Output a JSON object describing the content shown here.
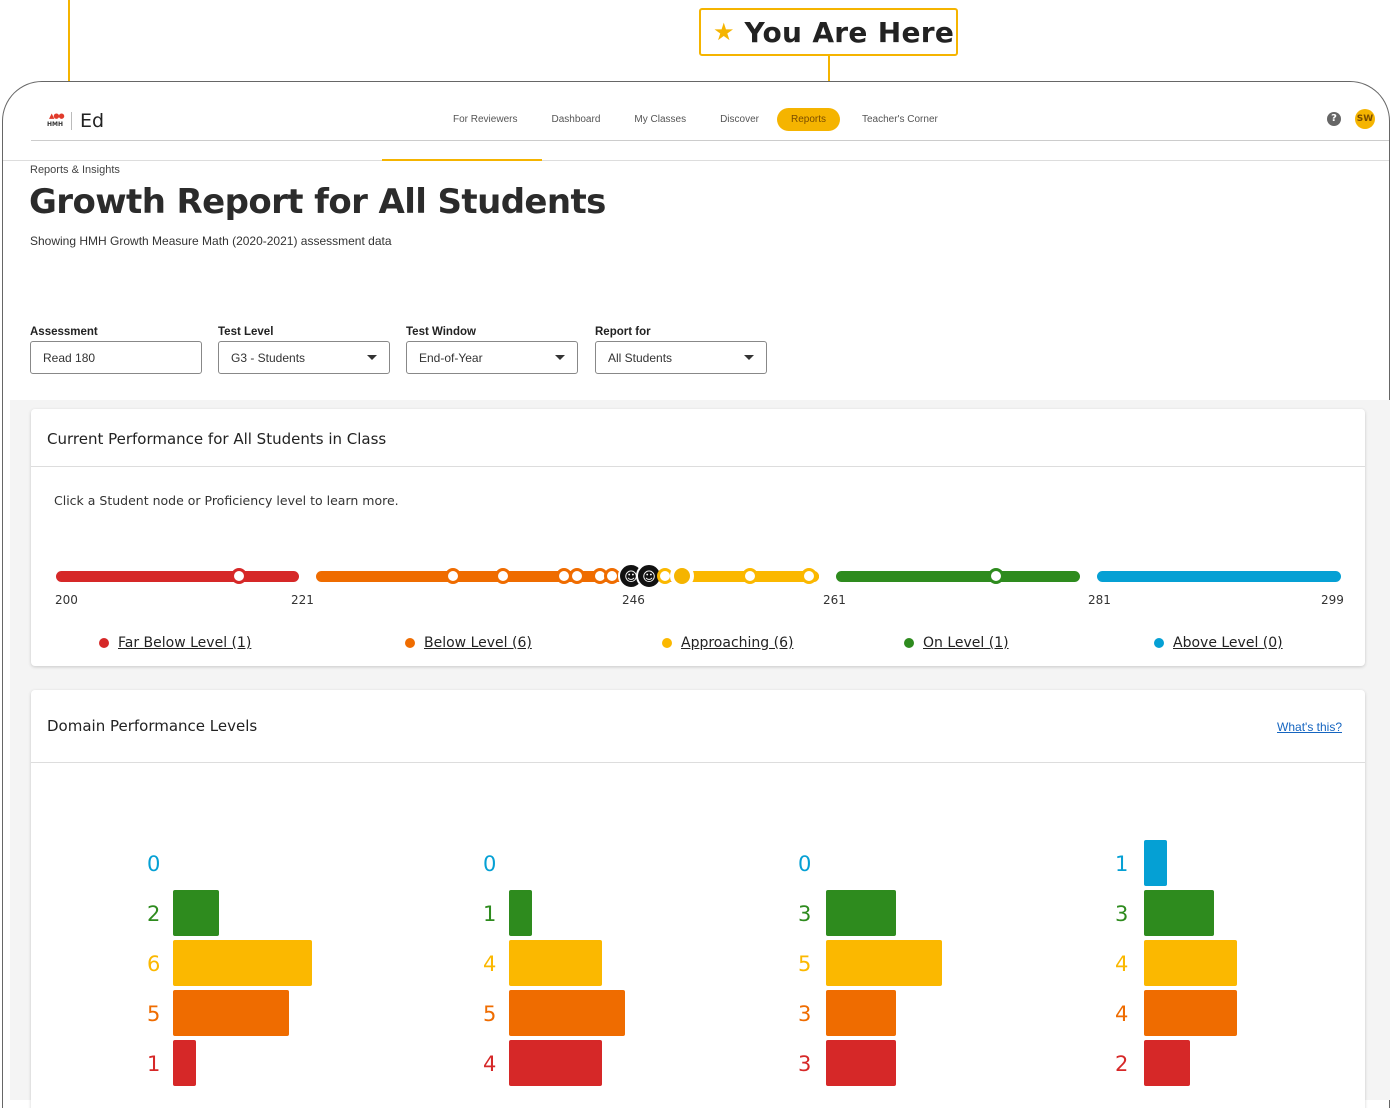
{
  "callout": {
    "label": "You Are Here"
  },
  "nav": {
    "brand": "Ed",
    "brand_mark": "HMH",
    "links": [
      "For Reviewers",
      "Dashboard",
      "My Classes",
      "Discover",
      "Reports",
      "Teacher's Corner"
    ],
    "active_link": "Reports",
    "help_icon": "?",
    "user_initials": "SW"
  },
  "header": {
    "breadcrumb": "Reports & Insights",
    "title": "Growth Report for All Students",
    "subtitle": "Showing HMH Growth Measure Math (2020-2021) assessment data"
  },
  "filters": {
    "assessment": {
      "label": "Assessment",
      "value": "Read 180"
    },
    "test_level": {
      "label": "Test Level",
      "value": "G3 - Students"
    },
    "test_window": {
      "label": "Test Window",
      "value": "End-of-Year"
    },
    "report_for": {
      "label": "Report for",
      "value": "All Students"
    }
  },
  "performance": {
    "title": "Current Performance for All Students in Class",
    "hint": "Click a Student node or Proficiency level to learn more.",
    "scale_ticks": [
      "200",
      "221",
      "246",
      "261",
      "281",
      "299"
    ],
    "levels": [
      {
        "label": "Far Below Level (1)",
        "color": "#d62828"
      },
      {
        "label": "Below Level (6)",
        "color": "#ef6c00"
      },
      {
        "label": "Approaching (6)",
        "color": "#fbb800"
      },
      {
        "label": "On Level (1)",
        "color": "#2e8b1e"
      },
      {
        "label": "Above Level (0)",
        "color": "#05a0d4"
      }
    ]
  },
  "domain": {
    "title": "Domain Performance Levels",
    "help_link": "What's this?",
    "level_colors": [
      "#05a0d4",
      "#2e8b1e",
      "#fbb800",
      "#ef6c00",
      "#d62828"
    ],
    "groups": [
      {
        "counts": [
          "0",
          "2",
          "6",
          "5",
          "1"
        ]
      },
      {
        "counts": [
          "0",
          "1",
          "4",
          "5",
          "4"
        ]
      },
      {
        "counts": [
          "0",
          "3",
          "5",
          "3",
          "3"
        ]
      },
      {
        "counts": [
          "1",
          "3",
          "4",
          "4",
          "2"
        ]
      }
    ]
  }
}
